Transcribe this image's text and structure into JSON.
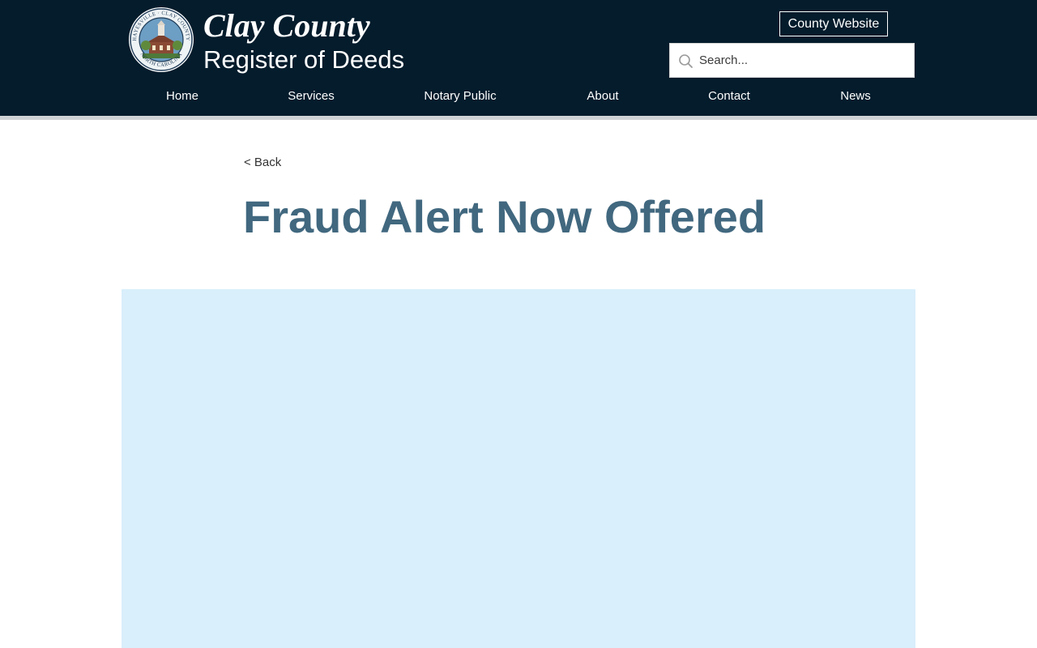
{
  "header": {
    "title": "Clay County",
    "subtitle": "Register of Deeds",
    "county_website_label": "County Website",
    "background_color": "#041c2c",
    "seal": {
      "ring_top_text": "HAYESVILLE · CLAY COUNTY",
      "ring_bottom_text": "NORTH CAROLINA"
    }
  },
  "search": {
    "placeholder": "Search...",
    "value": ""
  },
  "nav": {
    "items": [
      {
        "label": "Home"
      },
      {
        "label": "Services"
      },
      {
        "label": "Notary Public"
      },
      {
        "label": "About"
      },
      {
        "label": "Contact"
      },
      {
        "label": "News"
      }
    ]
  },
  "main": {
    "back_label": "< Back",
    "title": "Fraud Alert Now Offered",
    "title_color": "#41687f",
    "image_placeholder_color": "#d9effb"
  }
}
